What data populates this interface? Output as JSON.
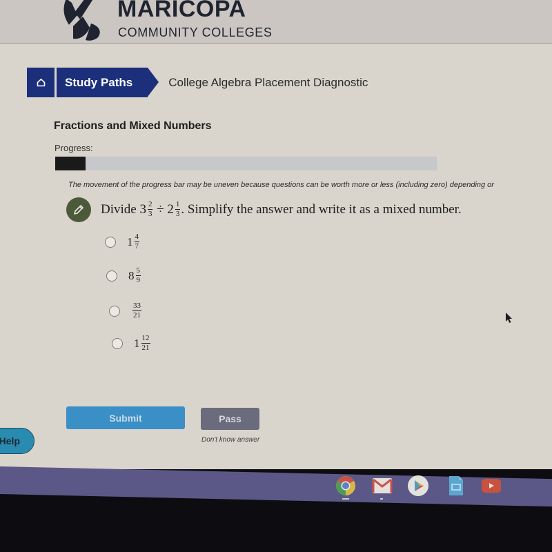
{
  "header": {
    "logo_title": "MARICOPA",
    "logo_subtitle": "COMMUNITY COLLEGES"
  },
  "breadcrumb": {
    "home_icon": "home-icon",
    "items": [
      {
        "label": "Study Paths"
      },
      {
        "label": "College Algebra Placement Diagnostic"
      }
    ]
  },
  "section": {
    "title": "Fractions and Mixed Numbers",
    "progress_label": "Progress:",
    "progress_percent": 8,
    "progress_note": "The movement of the progress bar may be uneven because questions can be worth more or less (including zero) depending or"
  },
  "question": {
    "icon": "pencil-icon",
    "prefix": "Divide ",
    "operand1": {
      "whole": "3",
      "num": "2",
      "den": "3"
    },
    "operator": " ÷ ",
    "operand2": {
      "whole": "2",
      "num": "1",
      "den": "3"
    },
    "suffix": ". Simplify the answer and write it as a mixed number.",
    "options": [
      {
        "whole": "1",
        "num": "4",
        "den": "7"
      },
      {
        "whole": "8",
        "num": "5",
        "den": "9"
      },
      {
        "whole": "",
        "num": "33",
        "den": "21"
      },
      {
        "whole": "1",
        "num": "12",
        "den": "21"
      }
    ]
  },
  "actions": {
    "submit_label": "Submit",
    "pass_label": "Pass",
    "pass_hint": "Don't know answer",
    "help_label": "Help"
  },
  "shelf": {
    "apps": [
      "chrome-icon",
      "gmail-icon",
      "play-store-icon",
      "docs-icon",
      "youtube-icon"
    ]
  }
}
